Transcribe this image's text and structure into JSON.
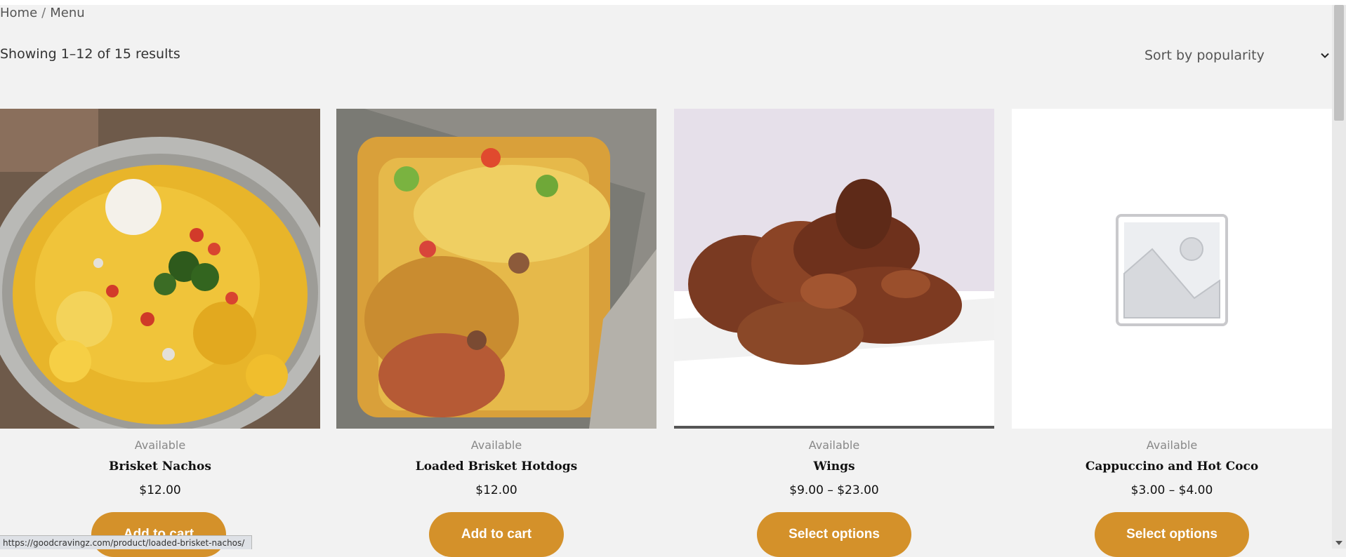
{
  "breadcrumb": {
    "home": "Home",
    "separator": "/",
    "current": "Menu"
  },
  "result_count": "Showing 1–12 of 15 results",
  "sort": {
    "selected": "Sort by popularity",
    "icon": "chevron-down-icon"
  },
  "products": [
    {
      "availability": "Available",
      "title": "Brisket Nachos",
      "price": "$12.00",
      "button": "Add to cart",
      "image": "nachos-photo"
    },
    {
      "availability": "Available",
      "title": "Loaded Brisket Hotdogs",
      "price": "$12.00",
      "button": "Add to cart",
      "image": "hotdogs-photo"
    },
    {
      "availability": "Available",
      "title": "Wings",
      "price": "$9.00 – $23.00",
      "button": "Select options",
      "image": "wings-photo"
    },
    {
      "availability": "Available",
      "title": "Cappuccino and Hot Coco",
      "price": "$3.00 – $4.00",
      "button": "Select options",
      "image": "placeholder-image-icon"
    }
  ],
  "status_bar": {
    "url": "https://goodcravingz.com/product/loaded-brisket-nachos/"
  },
  "colors": {
    "accent": "#d4912a",
    "background": "#f2f2f2"
  }
}
